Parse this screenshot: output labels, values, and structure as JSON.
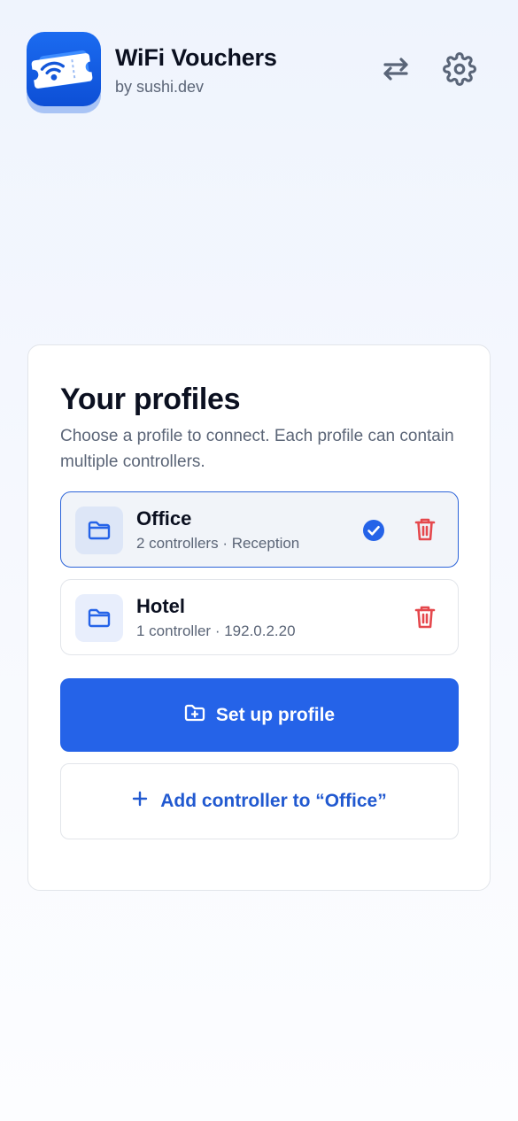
{
  "app": {
    "title": "WiFi Vouchers",
    "subtitle": "by sushi.dev",
    "icon": "wifi-ticket-icon",
    "brand_color": "#1b6bf0"
  },
  "header": {
    "swap_icon": "swap-arrows-icon",
    "settings_icon": "gear-icon"
  },
  "profiles_section": {
    "title": "Your profiles",
    "description": "Choose a profile to connect. Each profile can contain multiple controllers.",
    "profiles": [
      {
        "name": "Office",
        "meta": "2 controllers · Reception",
        "selected": true,
        "icon": "folder-icon"
      },
      {
        "name": "Hotel",
        "meta": "1 controller · 192.0.2.20",
        "selected": false,
        "icon": "folder-icon"
      }
    ],
    "setup_button": {
      "label": "Set up profile",
      "icon": "folder-plus-icon"
    },
    "add_controller_button": {
      "label": "Add controller to “Office”",
      "icon": "plus-icon"
    }
  },
  "colors": {
    "accent": "#2563e8",
    "delete": "#e5484d",
    "selected_border": "#2c64d9"
  }
}
